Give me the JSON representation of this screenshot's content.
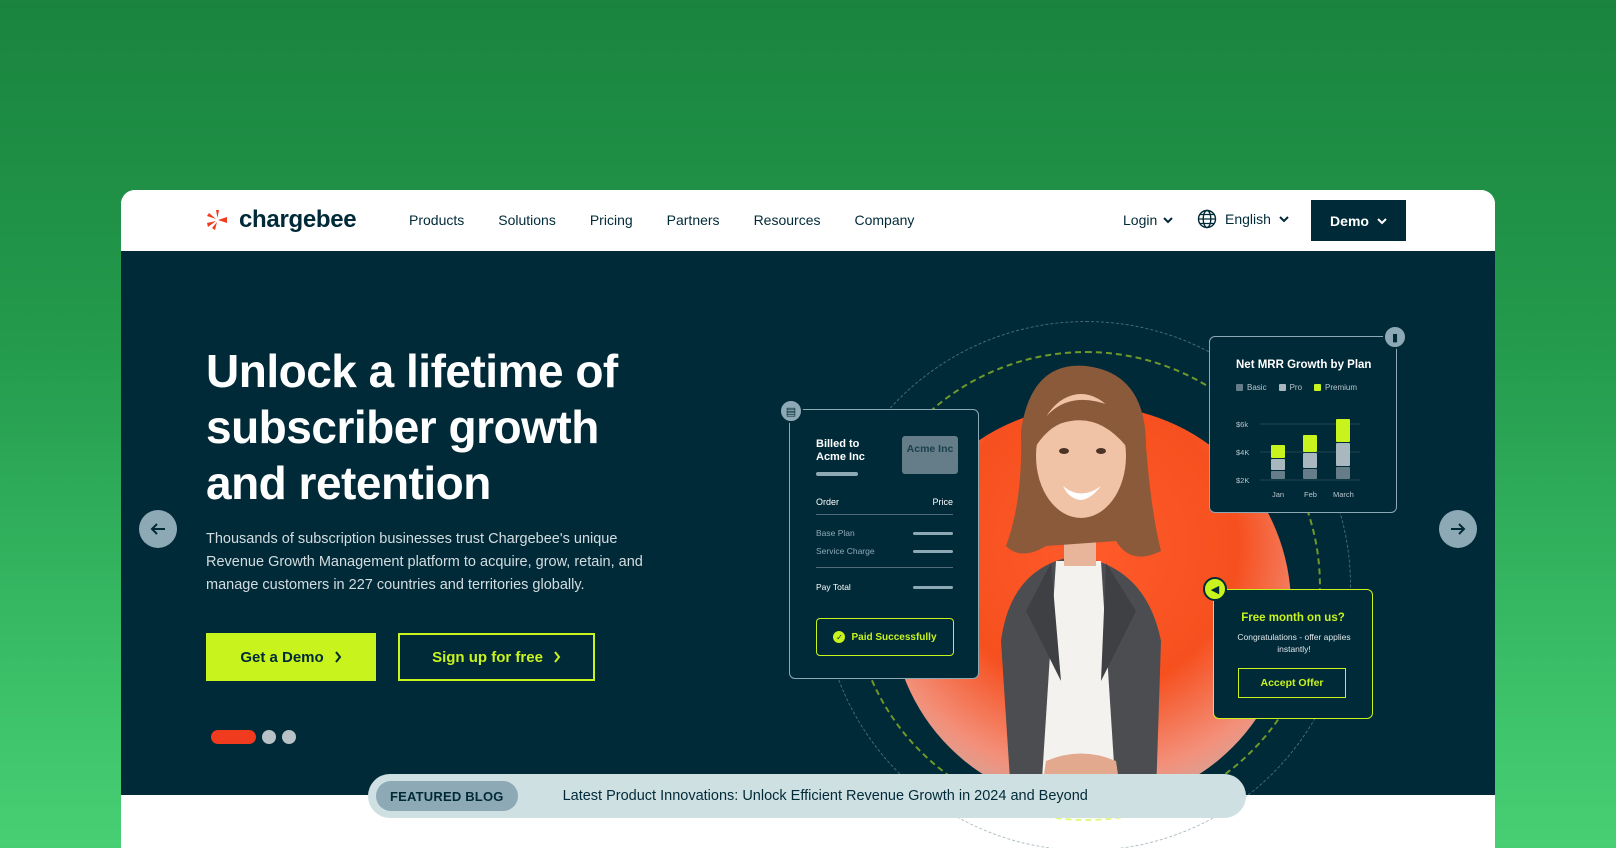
{
  "brand": {
    "name": "chargebee",
    "logo_color": "#f03b1f"
  },
  "nav": {
    "items": [
      "Products",
      "Solutions",
      "Pricing",
      "Partners",
      "Resources",
      "Company"
    ],
    "login_label": "Login",
    "language_label": "English",
    "demo_label": "Demo"
  },
  "hero": {
    "title": "Unlock a lifetime of subscriber growth and retention",
    "subtitle": "Thousands of subscription businesses trust Chargebee's unique Revenue Growth Management platform to acquire, grow, retain, and manage customers in 227 countries and territories globally.",
    "primary_cta": "Get a Demo",
    "secondary_cta": "Sign up for free",
    "carousel": {
      "slides": 3,
      "active": 1
    }
  },
  "invoice_card": {
    "billed_to": "Billed to Acme Inc",
    "tag": "Acme Inc",
    "col_order": "Order",
    "col_price": "Price",
    "row1": "Base Plan",
    "row2": "Service Charge",
    "total": "Pay Total",
    "status": "Paid Successfully"
  },
  "mrr_card": {
    "title": "Net MRR Growth by Plan",
    "legend": [
      "Basic",
      "Pro",
      "Premium"
    ],
    "y_ticks": [
      "$6k",
      "$4K",
      "$2K"
    ],
    "x_ticks": [
      "Jan",
      "Feb",
      "March"
    ]
  },
  "offer_card": {
    "title": "Free month on us?",
    "text": "Congratulations - offer applies instantly!",
    "button": "Accept Offer"
  },
  "blog": {
    "tag": "FEATURED BLOG",
    "headline": "Latest Product Innovations: Unlock Efficient Revenue Growth in 2024 and Beyond"
  },
  "colors": {
    "navy": "#012a38",
    "lime": "#c9f31d",
    "orange": "#f03b1f",
    "steel": "#8ea9b6"
  },
  "icons": [
    "chargebee-logo-icon",
    "chevron-down-icon",
    "globe-icon",
    "arrow-left-icon",
    "arrow-right-icon",
    "chevron-right-icon",
    "document-icon",
    "bar-chart-icon",
    "megaphone-icon",
    "check-icon"
  ]
}
